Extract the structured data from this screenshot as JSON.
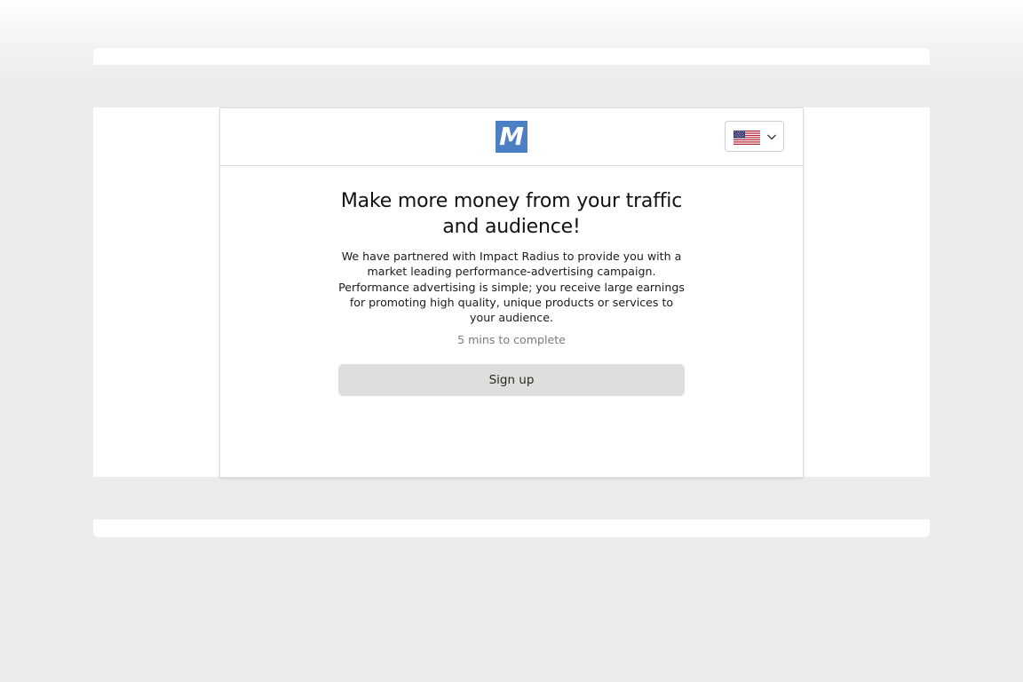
{
  "logo": {
    "letter": "M",
    "color": "#4d7fc4"
  },
  "language": {
    "selected_icon": "us-flag-icon",
    "dropdown_icon": "chevron-down-icon"
  },
  "main": {
    "title": "Make more money from your traffic and audience!",
    "description": "We have partnered with Impact Radius to provide you with a market leading performance-advertising campaign. Performance advertising is simple; you receive large earnings for promoting high quality, unique products or services to your audience.",
    "time_note": "5 mins to complete",
    "signup_label": "Sign up"
  }
}
